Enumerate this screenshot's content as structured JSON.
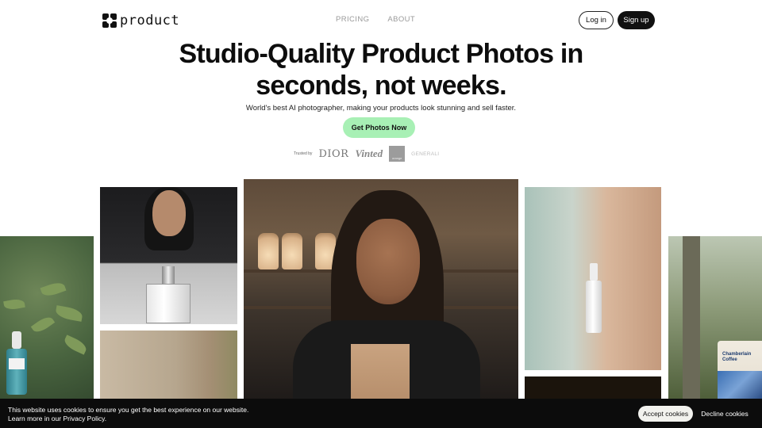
{
  "header": {
    "logo_text": "product",
    "nav": [
      {
        "label": "PRICING"
      },
      {
        "label": "ABOUT"
      }
    ],
    "login_label": "Log in",
    "signup_label": "Sign up"
  },
  "hero": {
    "title_line1": "Studio-Quality Product Photos in",
    "title_line2": "seconds, not weeks.",
    "subtitle": "World's best AI photographer, making your products look stunning and sell faster.",
    "cta_label": "Get Photos Now",
    "trusted_label": "Trusted by",
    "brands": [
      "DIOR",
      "Vinted",
      "orange",
      "GENERALI"
    ]
  },
  "colors": {
    "cta_bg": "#a8f0b5",
    "primary": "#111111",
    "cookie_bar_bg": "#0c0c0c"
  },
  "cookie_banner": {
    "line1": "This website uses cookies to ensure you get the best experience on our website.",
    "line2": "Learn more in our Privacy Policy.",
    "accept_label": "Accept cookies",
    "decline_label": "Decline cookies"
  },
  "coffee_bag_label": "Chamberlain Coffee"
}
